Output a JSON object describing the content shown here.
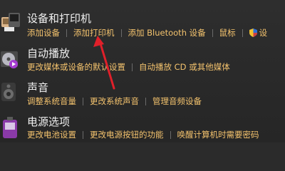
{
  "sections": [
    {
      "title": "设备和打印机",
      "icon": "devices-printers-icon",
      "links": [
        "添加设备",
        "添加打印机",
        "添加 Bluetooth 设备",
        "鼠标",
        "设"
      ]
    },
    {
      "title": "自动播放",
      "icon": "autoplay-icon",
      "links": [
        "更改媒体或设备的默认设置",
        "自动播放 CD 或其他媒体"
      ]
    },
    {
      "title": "声音",
      "icon": "speaker-icon",
      "links": [
        "调整系统音量",
        "更改系统声音",
        "管理音频设备"
      ]
    },
    {
      "title": "电源选项",
      "icon": "power-options-icon",
      "links": [
        "更改电池设置",
        "更改电源按钮的功能",
        "唤醒计算机时需要密码"
      ]
    }
  ],
  "colors": {
    "background": "#2b2b2b",
    "title": "#f0f0f0",
    "link": "#f3c26d",
    "arrow": "#e0202a"
  },
  "annotation": "red-arrow-pointing-to-add-printer"
}
